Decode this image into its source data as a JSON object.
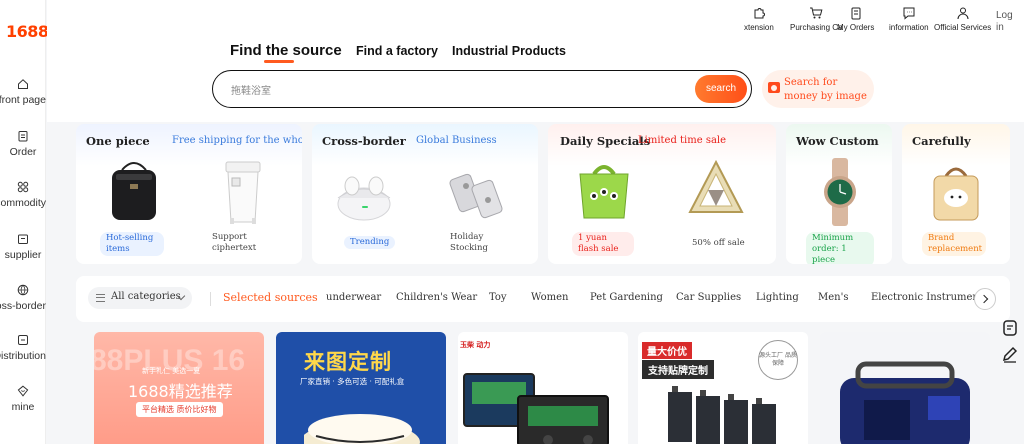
{
  "logo": "1688",
  "sidebar": {
    "items": [
      {
        "label": "front page",
        "icon": "home-icon"
      },
      {
        "label": "Order",
        "icon": "order-icon"
      },
      {
        "label": "commodity",
        "icon": "grid-icon"
      },
      {
        "label": "supplier",
        "icon": "supplier-icon"
      },
      {
        "label": "Cross-border",
        "icon": "globe-icon"
      },
      {
        "label": "Distribution",
        "icon": "distribution-icon"
      },
      {
        "label": "mine",
        "icon": "user-icon"
      }
    ]
  },
  "topbar": {
    "items": [
      {
        "label": "xtension",
        "icon": "extension-icon"
      },
      {
        "label": "Purchasing Ca",
        "icon": "cart-icon"
      },
      {
        "label": "My Orders",
        "icon": "clipboard-icon"
      },
      {
        "label": "information",
        "icon": "message-icon"
      },
      {
        "label": "Official Services",
        "icon": "person-icon"
      }
    ],
    "login": "Log in"
  },
  "tabs": [
    "Find the source",
    "Find a factory",
    "Industrial Products"
  ],
  "search": {
    "placeholder": "拖鞋浴室",
    "button": "search",
    "image_search": "Search for money by image"
  },
  "cards": [
    {
      "title": "One piece",
      "subtitle": "Free shipping for the whole",
      "items": [
        {
          "label": "Hot-selling items",
          "style": "blue"
        },
        {
          "label": "Support ciphertext",
          "style": "plain"
        }
      ]
    },
    {
      "title": "Cross-border",
      "subtitle": "Global Business",
      "items": [
        {
          "label": "Trending",
          "style": "blue"
        },
        {
          "label": "Holiday Stocking",
          "style": "plain"
        }
      ]
    },
    {
      "title": "Daily Specials",
      "subtitle": "Limited time sale",
      "items": [
        {
          "label": "1 yuan flash sale",
          "style": "red"
        },
        {
          "label": "50% off sale",
          "style": "plain"
        }
      ]
    },
    {
      "title": "Wow Custom",
      "subtitle": "",
      "items": [
        {
          "label": "Minimum order: 1 piece",
          "style": "green"
        }
      ]
    },
    {
      "title": "Carefully",
      "subtitle": "",
      "items": [
        {
          "label": "Brand replacement",
          "style": "orange"
        }
      ]
    }
  ],
  "categories": {
    "all": "All categories",
    "selected": "Selected sources",
    "items": [
      "underwear",
      "Children's Wear",
      "Toy",
      "Women",
      "Pet Gardening",
      "Car Supplies",
      "Lighting",
      "Men's",
      "Electronic Instruments"
    ]
  },
  "tiles": [
    {
      "big": "88PLUS 16",
      "line1": "新手礼仁 美选一夏",
      "title": "1688精选推荐",
      "badge": "平台精选 质价比好物"
    },
    {
      "title": "来图定制",
      "line1": "厂家直销 · 多色可选 · 可配礼盒"
    },
    {
      "brand": "玉柴 动力"
    },
    {
      "title": "量大价优",
      "line1": "支持贴牌定制",
      "stamp": "源头工厂 品质保障"
    },
    {}
  ],
  "colors": {
    "brand": "#ff4000",
    "accent": "#ff5a1f",
    "link": "#3a7bdc"
  }
}
